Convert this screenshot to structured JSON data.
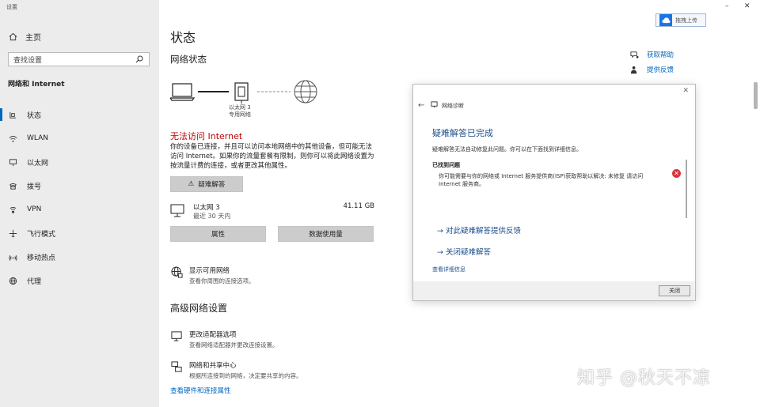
{
  "window": {
    "title": "设置"
  },
  "sidebar": {
    "home_label": "主页",
    "search_placeholder": "查找设置",
    "category": "网络和 Internet",
    "items": [
      {
        "label": "状态",
        "icon": "home-net-icon",
        "active": true
      },
      {
        "label": "WLAN",
        "icon": "wifi-icon"
      },
      {
        "label": "以太网",
        "icon": "ethernet-icon"
      },
      {
        "label": "拨号",
        "icon": "dialup-icon"
      },
      {
        "label": "VPN",
        "icon": "vpn-icon"
      },
      {
        "label": "飞行模式",
        "icon": "airplane-icon"
      },
      {
        "label": "移动热点",
        "icon": "hotspot-icon"
      },
      {
        "label": "代理",
        "icon": "globe-icon"
      }
    ]
  },
  "main": {
    "title": "状态",
    "network_status_heading": "网络状态",
    "diagram_label_line1": "以太网 3",
    "diagram_label_line2": "专用网络",
    "error_title": "无法访问 Internet",
    "error_text": "你的设备已连接，并且可以访问本地网络中的其他设备，但可能无法访问 Internet。如果你的流量套餐有限制，则你可以将此网络设置为按流量计费的连接，或者更改其他属性。",
    "troubleshoot_label": "疑难解答",
    "ethernet": {
      "name": "以太网 3",
      "sub": "最近 30 天内",
      "size": "41.11 GB"
    },
    "properties_label": "属性",
    "data_usage_label": "数据使用量",
    "show_networks": {
      "title": "显示可用网络",
      "sub": "查看你周围的连接选项。"
    },
    "advanced_heading": "高级网络设置",
    "adapter_options": {
      "title": "更改适配器选项",
      "sub": "查看网络适配器并更改连接设置。"
    },
    "sharing_center": {
      "title": "网络和共享中心",
      "sub": "根据所连接到的网络，决定要共享的内容。"
    },
    "hardware_link": "查看硬件和连接属性"
  },
  "right": {
    "upload_label": "拖拽上传",
    "help_label": "获取帮助",
    "feedback_label": "提供反馈"
  },
  "dialog": {
    "title": "网络诊断",
    "heading": "疑难解答已完成",
    "description": "疑难解答无法自动修复此问题。你可以在下面找到详细信息。",
    "found_label": "已找到问题",
    "issue_text": "你可能需要与你的网络或 Internet 服务提供商(ISP)获取帮助以解决: 未修复 请访问 Internet 服务商。",
    "link1": "→ 对此疑难解答提供反馈",
    "link2": "→ 关闭疑难解答",
    "more_link": "查看详细信息",
    "close_button": "关闭"
  },
  "watermark": "知乎 @秋天不凉"
}
